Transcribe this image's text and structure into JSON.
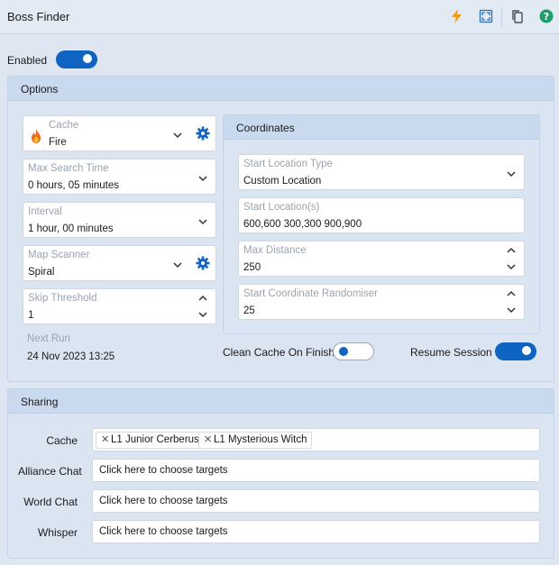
{
  "window": {
    "title": "Boss Finder"
  },
  "toolbar": {
    "icons": [
      "lightning-icon",
      "fullscreen-icon",
      "copy-icon",
      "help-icon"
    ],
    "colors": {
      "lightning": "#f39c12",
      "help": "#1e9e6a"
    }
  },
  "enabled": {
    "label": "Enabled",
    "on": true
  },
  "options": {
    "title": "Options",
    "cache": {
      "label": "Cache",
      "value": "Fire"
    },
    "max_search_time": {
      "label": "Max Search Time",
      "value": "0 hours, 05 minutes"
    },
    "interval": {
      "label": "Interval",
      "value": "1 hour, 00 minutes"
    },
    "map_scanner": {
      "label": "Map Scanner",
      "value": "Spiral"
    },
    "skip_threshold": {
      "label": "Skip Threshold",
      "value": "1"
    },
    "next_run": {
      "label": "Next Run",
      "value": "24 Nov 2023 13:25"
    },
    "coordinates": {
      "title": "Coordinates",
      "start_location_type": {
        "label": "Start Location Type",
        "value": "Custom Location"
      },
      "start_locations": {
        "label": "Start Location(s)",
        "value": "600,600 300,300 900,900"
      },
      "max_distance": {
        "label": "Max Distance",
        "value": "250"
      },
      "start_coordinate_randomiser": {
        "label": "Start Coordinate Randomiser",
        "value": "25"
      }
    },
    "clean_cache_on_finish": {
      "label": "Clean Cache On Finish",
      "on": false
    },
    "resume_session": {
      "label": "Resume Session",
      "on": true
    }
  },
  "sharing": {
    "title": "Sharing",
    "cache": {
      "label": "Cache",
      "chips": [
        "L1 Junior Cerberus",
        "L1 Mysterious Witch"
      ]
    },
    "alliance_chat": {
      "label": "Alliance Chat",
      "placeholder": "Click here to choose targets"
    },
    "world_chat": {
      "label": "World Chat",
      "placeholder": "Click here to choose targets"
    },
    "whisper": {
      "label": "Whisper",
      "placeholder": "Click here to choose targets"
    }
  },
  "colors": {
    "accent": "#0e64c0",
    "panel_header": "#c9d9ee",
    "background": "#dde6f1"
  }
}
